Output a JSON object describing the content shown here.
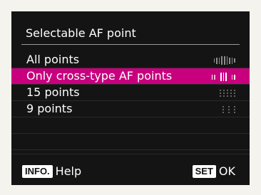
{
  "screen": {
    "title": "Selectable AF point",
    "options": [
      {
        "label": "All points",
        "icon": "all-points-pattern-icon",
        "selected": false
      },
      {
        "label": "Only cross-type AF points",
        "icon": "cross-type-pattern-icon",
        "selected": true
      },
      {
        "label": "15 points",
        "icon": "fifteen-points-pattern-icon",
        "selected": false
      },
      {
        "label": "9 points",
        "icon": "nine-points-pattern-icon",
        "selected": false
      }
    ],
    "info_badge": "INFO.",
    "info_label": "Help",
    "set_badge": "SET",
    "set_label": "OK"
  },
  "colors": {
    "background": "#141414",
    "highlight": "#c8007e",
    "text": "#ffffff",
    "frame": "#f5f3ee"
  }
}
